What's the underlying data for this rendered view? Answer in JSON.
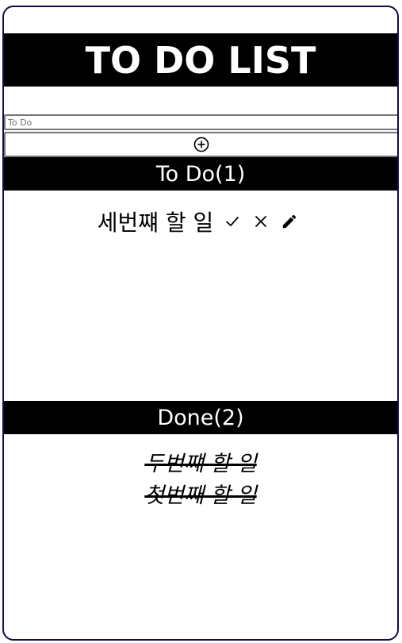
{
  "header": {
    "title": "TO DO LIST"
  },
  "form": {
    "input_placeholder": "To Do",
    "input_value": "",
    "add_icon": "circle-plus-icon"
  },
  "todo_section": {
    "label": "To Do(1)",
    "items": [
      {
        "text": "세번쨰 할 일",
        "icons": [
          "check-icon",
          "close-icon",
          "pencil-icon"
        ]
      }
    ]
  },
  "done_section": {
    "label": "Done(2)",
    "items": [
      {
        "text": "두번쨰 할 일"
      },
      {
        "text": "첫번째 할 일"
      }
    ]
  },
  "colors": {
    "bar_background": "#000000",
    "bar_text": "#ffffff",
    "frame_border": "#0e0e4a"
  }
}
